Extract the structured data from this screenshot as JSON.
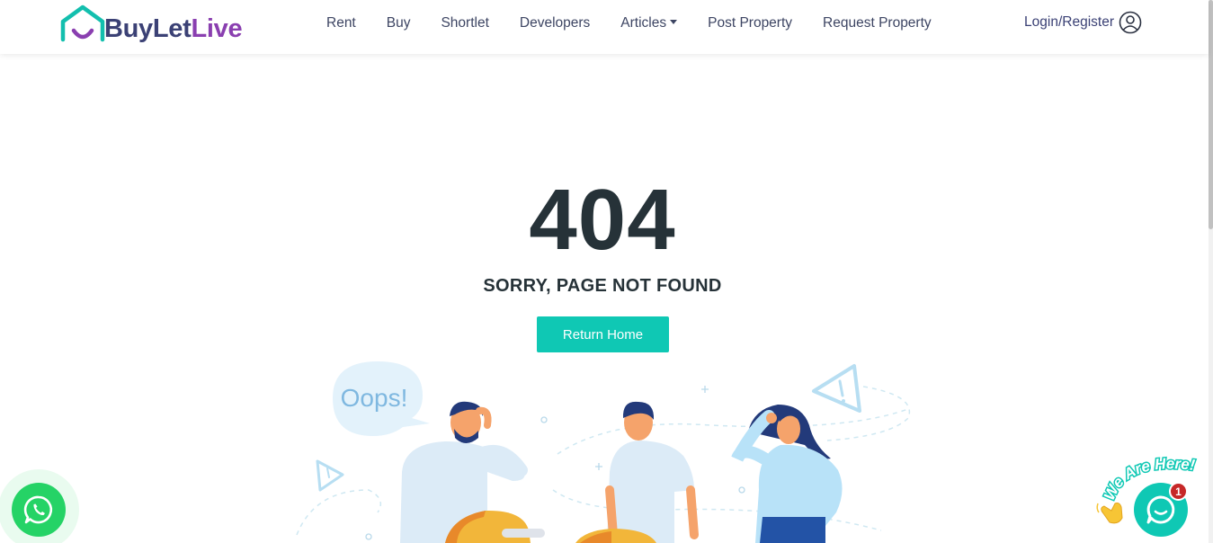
{
  "brand": {
    "name_part1": "BuyLet",
    "name_part2": "Live",
    "colors": {
      "teal": "#0fc8b4",
      "navy": "#3b4175",
      "purple": "#8a3fb0"
    }
  },
  "nav": {
    "items": [
      {
        "label": "Rent"
      },
      {
        "label": "Buy"
      },
      {
        "label": "Shortlet"
      },
      {
        "label": "Developers"
      },
      {
        "label": "Articles",
        "has_dropdown": true
      },
      {
        "label": "Post Property"
      },
      {
        "label": "Request Property"
      }
    ],
    "login_label": "Login/Register",
    "login_icon": "user-circle-icon"
  },
  "error": {
    "code": "404",
    "message": "SORRY, PAGE NOT FOUND",
    "button_label": "Return Home"
  },
  "illustration": {
    "speech_text": "Oops!"
  },
  "widgets": {
    "whatsapp_icon": "whatsapp-icon",
    "chat_icon": "chat-bubble-icon",
    "chat_badge_count": "1",
    "chat_tagline": "We Are Here!",
    "wave_icon": "waving-hand-icon"
  }
}
